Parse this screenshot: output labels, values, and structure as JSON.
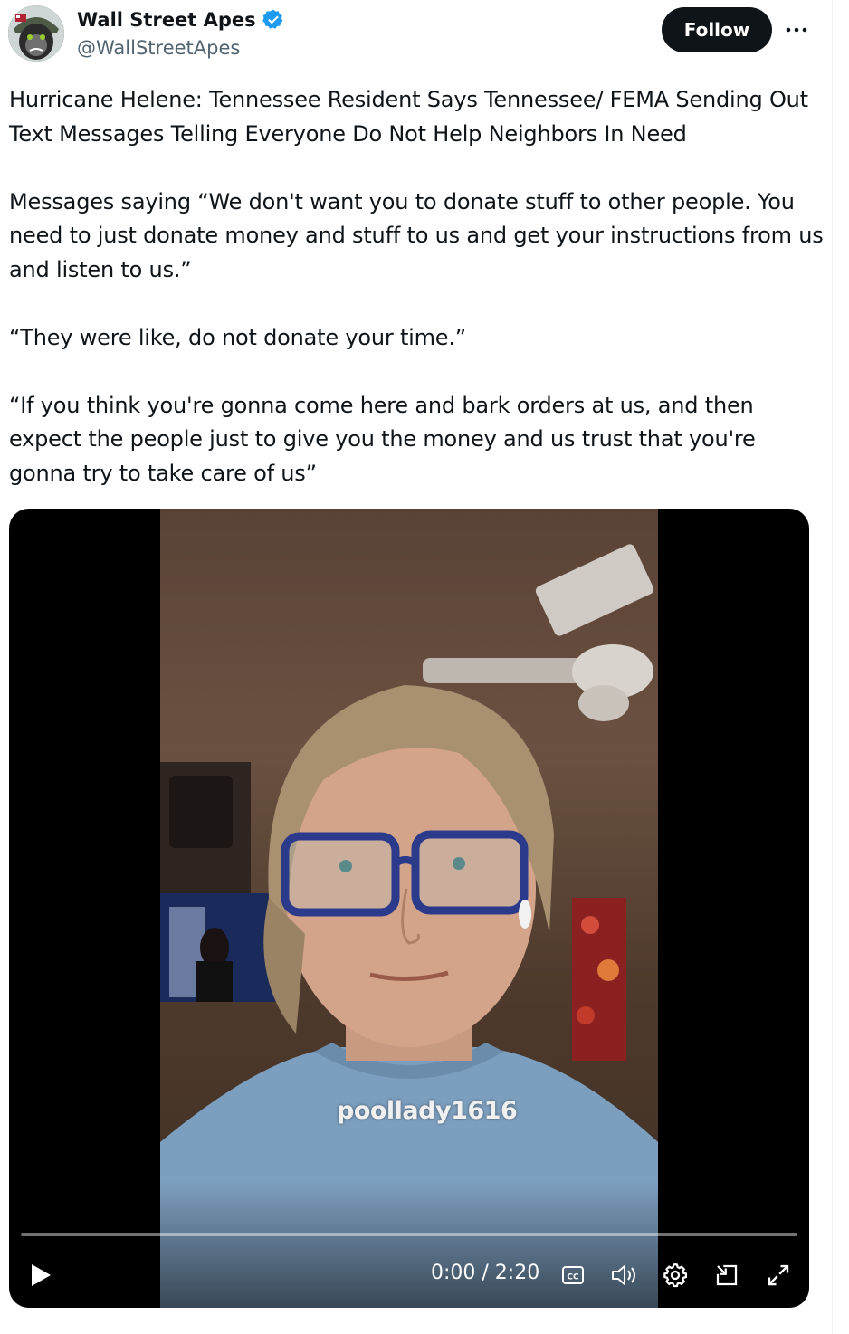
{
  "author": {
    "name": "Wall Street Apes",
    "handle": "@WallStreetApes",
    "verified": true
  },
  "follow_label": "Follow",
  "post": {
    "paragraphs": [
      "Hurricane Helene: Tennessee Resident Says Tennessee/ FEMA Sending Out Text Messages Telling Everyone Do Not Help Neighbors In Need",
      "Messages saying “We don't want you to donate stuff to other people. You need to just donate money and stuff to us and get your instructions from us and listen to us.”",
      "“They were like, do not donate your time.”",
      "“If you think you're gonna come here and bark orders at us, and then expect the people just to give you the money and us trust that you're gonna try to take care of us”"
    ]
  },
  "video": {
    "watermark": "poollady1616",
    "time": "0:00 / 2:20",
    "progress": 0
  },
  "icons": {
    "verified": "verified-badge-icon",
    "more": "more-horizontal-icon",
    "play": "play-icon",
    "captions": "captions-icon",
    "volume": "volume-icon",
    "settings": "gear-icon",
    "pip": "picture-in-picture-icon",
    "fullscreen": "fullscreen-icon"
  },
  "colors": {
    "verified": "#1d9bf0",
    "text": "#0f1419",
    "secondary": "#536471",
    "follow_bg": "#0f1419"
  }
}
